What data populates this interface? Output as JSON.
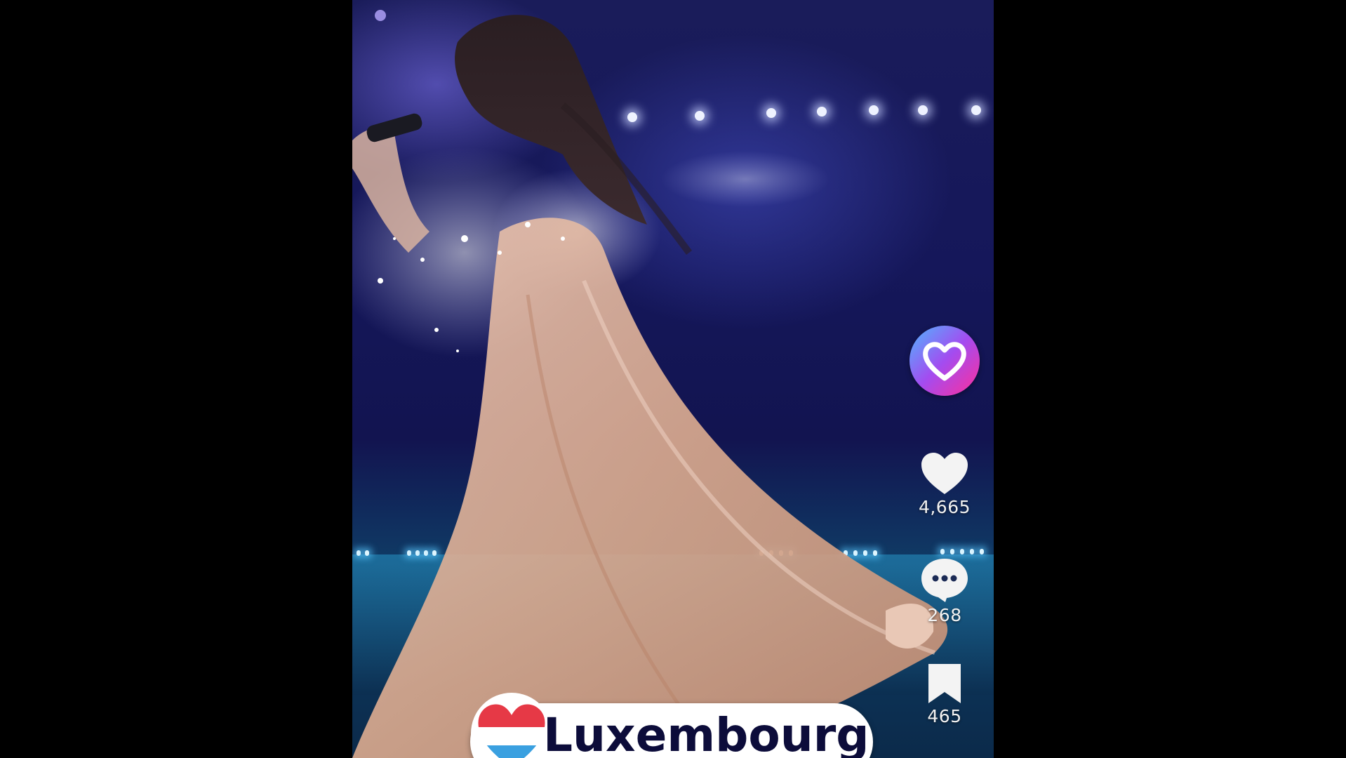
{
  "video": {
    "country_label": "Luxembourg"
  },
  "actions": {
    "like_count": "4,665",
    "comment_count": "268",
    "save_count": "465"
  },
  "icons": {
    "creator_badge": "heart-badge-icon",
    "like": "heart-icon",
    "comment": "comment-bubble-icon",
    "save": "bookmark-icon",
    "flag": "luxembourg-heart-flag-icon"
  },
  "colors": {
    "background": "#000000",
    "stage_blue": "#15175a",
    "badge_gradient_start": "#4db8ff",
    "badge_gradient_end": "#ff2e9a",
    "flag_red": "#e63946",
    "flag_blue": "#3aa0e0",
    "banner_text": "#0c0c3a"
  }
}
